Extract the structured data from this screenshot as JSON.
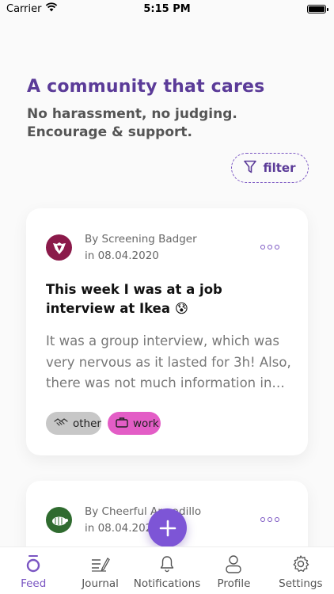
{
  "status_bar": {
    "carrier": "Carrier",
    "time": "5:15 PM"
  },
  "header": {
    "title": "A community that cares",
    "subtitle_line1": "No harassment, no judging.",
    "subtitle_line2": "Encourage & support."
  },
  "filter": {
    "label": "filter",
    "icon": "funnel-icon"
  },
  "posts": [
    {
      "author": "By Screening Badger",
      "date": "in 08.04.2020",
      "avatar_color": "#8b1a4a",
      "title": "This week I was at a job interview at Ikea 😰",
      "body": "It was a group interview, which was very nervous as it lasted for 3h! Also, there was not much information in…",
      "tags": [
        {
          "label": "other",
          "icon": "handshake-icon",
          "color": "#c7c7c7"
        },
        {
          "label": "work",
          "icon": "briefcase-icon",
          "color": "#e35dc6"
        }
      ]
    },
    {
      "author": "By Cheerful Armadillo",
      "date": "in 08.04.2020",
      "avatar_color": "#2f6b2f"
    }
  ],
  "tabs": [
    {
      "label": "Feed",
      "icon": "feed-icon",
      "active": true
    },
    {
      "label": "Journal",
      "icon": "journal-icon",
      "active": false
    },
    {
      "label": "Notifications",
      "icon": "bell-icon",
      "active": false
    },
    {
      "label": "Profile",
      "icon": "profile-icon",
      "active": false
    },
    {
      "label": "Settings",
      "icon": "gear-icon",
      "active": false
    }
  ],
  "colors": {
    "accent": "#7a55c2",
    "headline": "#5b3b98",
    "fab": "#7d55d6"
  }
}
